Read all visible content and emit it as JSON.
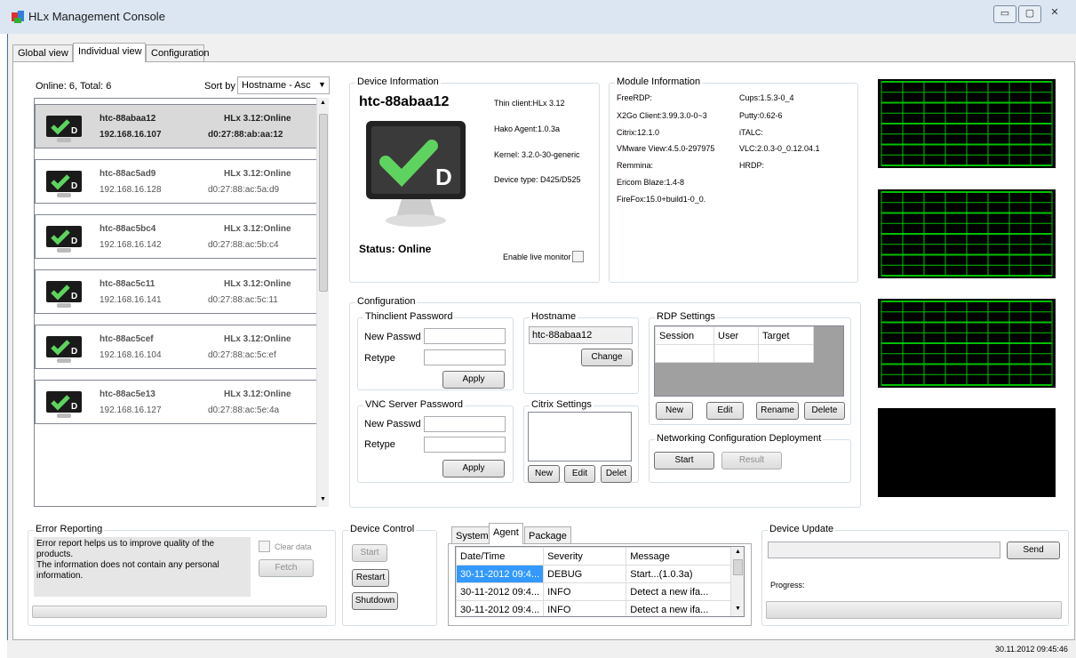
{
  "window": {
    "title": "HLx Management Console"
  },
  "tabs": [
    "Global view",
    "Individual view",
    "Configuration"
  ],
  "devices_panel": {
    "online_total": "Online: 6, Total: 6",
    "sort_label": "Sort by",
    "sort_value": "Hostname - Asc"
  },
  "devices": [
    {
      "hostname": "htc-88abaa12",
      "version": "HLx 3.12:Online",
      "ip": "192.168.16.107",
      "mac": "d0:27:88:ab:aa:12"
    },
    {
      "hostname": "htc-88ac5ad9",
      "version": "HLx 3.12:Online",
      "ip": "192.168.16.128",
      "mac": "d0:27:88:ac:5a:d9"
    },
    {
      "hostname": "htc-88ac5bc4",
      "version": "HLx 3.12:Online",
      "ip": "192.168.16.142",
      "mac": "d0:27:88:ac:5b:c4"
    },
    {
      "hostname": "htc-88ac5c11",
      "version": "HLx 3.12:Online",
      "ip": "192.168.16.141",
      "mac": "d0:27:88:ac:5c:11"
    },
    {
      "hostname": "htc-88ac5cef",
      "version": "HLx 3.12:Online",
      "ip": "192.168.16.104",
      "mac": "d0:27:88:ac:5c:ef"
    },
    {
      "hostname": "htc-88ac5e13",
      "version": "HLx 3.12:Online",
      "ip": "192.168.16.127",
      "mac": "d0:27:88:ac:5e:4a"
    }
  ],
  "device_info": {
    "title": "Device Information",
    "hostname": "htc-88abaa12",
    "thin_client": "Thin client:HLx 3.12",
    "hako_agent": "Hako Agent:1.0.3a",
    "kernel": "Kernel: 3.2.0-30-generic",
    "device_type": "Device type: D425/D525",
    "status": "Status: Online",
    "live_monitor": "Enable live monitor",
    "monitor_letter": "D"
  },
  "module_info": {
    "title": "Module Information",
    "left": [
      "FreeRDP:",
      "X2Go Client:3.99.3.0-0~3",
      "Citrix:12.1.0",
      "VMware View:4.5.0-297975",
      "Remmina:",
      "Ericom Blaze:1.4-8",
      "FireFox:15.0+build1-0_0."
    ],
    "right": [
      "Cups:1.5.3-0_4",
      "Putty:0.62-6",
      "iTALC:",
      "VLC:2.0.3-0_0.12.04.1",
      "HRDP:"
    ]
  },
  "configuration": {
    "title": "Configuration",
    "thin_pw": {
      "title": "Thinclient Password",
      "new": "New Passwd",
      "retype": "Retype",
      "apply": "Apply"
    },
    "vnc_pw": {
      "title": "VNC Server Password",
      "new": "New Passwd",
      "retype": "Retype",
      "apply": "Apply"
    },
    "hostname": {
      "title": "Hostname",
      "value": "htc-88abaa12",
      "change": "Change"
    },
    "citrix": {
      "title": "Citrix Settings",
      "new": "New",
      "edit": "Edit",
      "delete": "Delet"
    },
    "rdp": {
      "title": "RDP Settings",
      "cols": [
        "Session",
        "User",
        "Target"
      ],
      "new": "New",
      "edit": "Edit",
      "rename": "Rename",
      "delete": "Delete"
    },
    "network": {
      "title": "Networking Configuration Deployment",
      "start": "Start",
      "result": "Result"
    }
  },
  "error_reporting": {
    "title": "Error Reporting",
    "text": "Error report helps us to improve quality of the products.\nThe information does not contain any personal information.",
    "clear": "Clear data",
    "fetch": "Fetch"
  },
  "device_control": {
    "title": "Device Control",
    "start": "Start",
    "restart": "Restart",
    "shutdown": "Shutdown"
  },
  "log": {
    "tabs": [
      "System",
      "Agent",
      "Package"
    ],
    "cols": [
      "Date/Time",
      "Severity",
      "Message"
    ],
    "rows": [
      [
        "30-11-2012 09:4...",
        "DEBUG",
        "Start...(1.0.3a)"
      ],
      [
        "30-11-2012 09:4...",
        "INFO",
        "Detect a new ifa..."
      ],
      [
        "30-11-2012 09:4...",
        "INFO",
        "Detect a new ifa..."
      ]
    ]
  },
  "device_update": {
    "title": "Device Update",
    "send": "Send",
    "progress": "Progress:",
    "progress_value": 0
  },
  "statusbar": {
    "datetime": "30.11.2012 09:45:46"
  },
  "colors": {
    "grid_green": "#00c000",
    "selection": "#3399ff",
    "title_bg": "#dbe6f2"
  }
}
